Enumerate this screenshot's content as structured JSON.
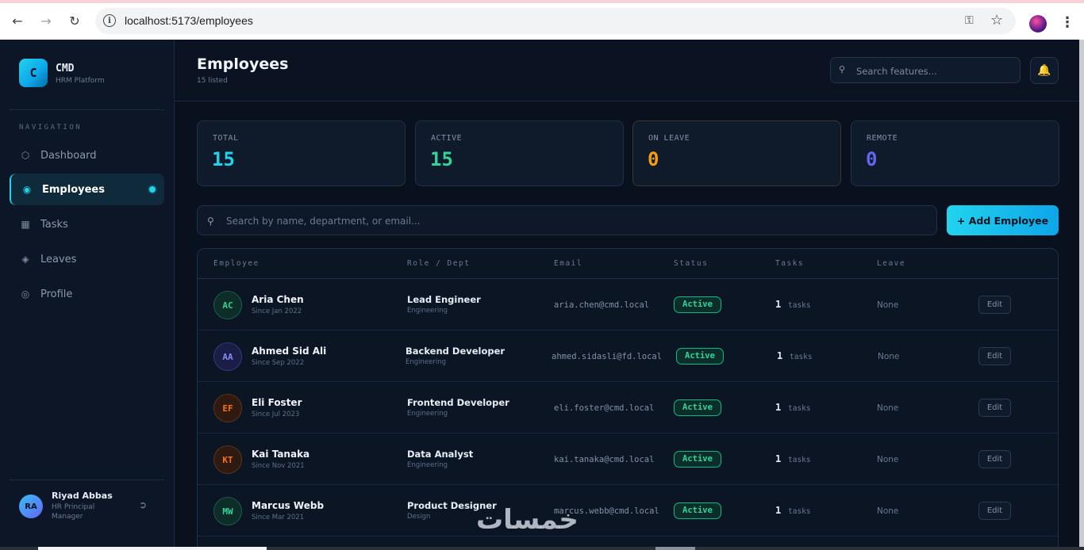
{
  "browser": {
    "url": "localhost:5173/employees"
  },
  "sidebar": {
    "logo_letter": "C",
    "brand": "CMD",
    "brand_sub": "HRM Platform",
    "nav_heading": "NAVIGATION",
    "items": [
      {
        "label": "Dashboard",
        "icon": "hexagon-icon"
      },
      {
        "label": "Employees",
        "icon": "target-icon"
      },
      {
        "label": "Tasks",
        "icon": "grid-icon"
      },
      {
        "label": "Leaves",
        "icon": "diamond-icon"
      },
      {
        "label": "Profile",
        "icon": "circle-icon"
      }
    ],
    "user": {
      "initials": "RA",
      "name": "Riyad Abbas",
      "role": "HR Principal Manager"
    }
  },
  "header": {
    "title": "Employees",
    "subtitle": "15 listed",
    "search_placeholder": "Search features..."
  },
  "stats": [
    {
      "label": "TOTAL",
      "value": "15",
      "color": "#22d3ee"
    },
    {
      "label": "ACTIVE",
      "value": "15",
      "color": "#34d399"
    },
    {
      "label": "ON LEAVE",
      "value": "0",
      "color": "#f59e0b"
    },
    {
      "label": "REMOTE",
      "value": "0",
      "color": "#6366f1"
    }
  ],
  "table_search_placeholder": "Search by name, department, or email...",
  "add_button": "+ Add Employee",
  "table": {
    "headers": [
      "Employee",
      "Role / Dept",
      "Email",
      "Status",
      "Tasks",
      "Leave"
    ],
    "rows": [
      {
        "initials": "AC",
        "name": "Aria Chen",
        "since": "Since Jan 2022",
        "role": "Lead Engineer",
        "dept": "Engineering",
        "email": "aria.chen@cmd.local",
        "status": "Active",
        "tasks": "1",
        "tasks_label": "tasks",
        "leave": "None",
        "edit": "Edit"
      },
      {
        "initials": "AA",
        "name": "Ahmed Sid Ali",
        "since": "Since Sep 2022",
        "role": "Backend Developer",
        "dept": "Engineering",
        "email": "ahmed.sidasli@fd.local",
        "status": "Active",
        "tasks": "1",
        "tasks_label": "tasks",
        "leave": "None",
        "edit": "Edit"
      },
      {
        "initials": "EF",
        "name": "Eli Foster",
        "since": "Since Jul 2023",
        "role": "Frontend Developer",
        "dept": "Engineering",
        "email": "eli.foster@cmd.local",
        "status": "Active",
        "tasks": "1",
        "tasks_label": "tasks",
        "leave": "None",
        "edit": "Edit"
      },
      {
        "initials": "KT",
        "name": "Kai Tanaka",
        "since": "Since Nov 2021",
        "role": "Data Analyst",
        "dept": "Engineering",
        "email": "kai.tanaka@cmd.local",
        "status": "Active",
        "tasks": "1",
        "tasks_label": "tasks",
        "leave": "None",
        "edit": "Edit"
      },
      {
        "initials": "MW",
        "name": "Marcus Webb",
        "since": "Since Mar 2021",
        "role": "Product Designer",
        "dept": "Design",
        "email": "marcus.webb@cmd.local",
        "status": "Active",
        "tasks": "1",
        "tasks_label": "tasks",
        "leave": "None",
        "edit": "Edit"
      }
    ]
  },
  "avatar_colors": {
    "AC": "#34d399",
    "AA": "#818cf8",
    "EF": "#f97316",
    "KT": "#f97316",
    "MW": "#34d399"
  },
  "watermark": "خمسات"
}
